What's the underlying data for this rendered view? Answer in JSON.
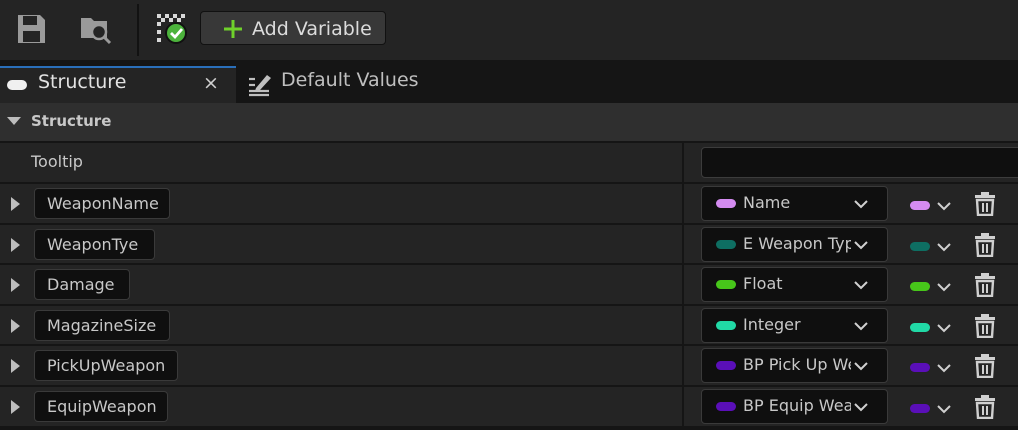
{
  "toolbar": {
    "save_icon": "save-icon",
    "browse_icon": "browse-folder-icon",
    "compile_icon": "compile-ok-icon",
    "add_variable_label": "Add Variable"
  },
  "tabs": [
    {
      "label": "Structure",
      "active": true,
      "close": "×"
    },
    {
      "label": "Default Values",
      "active": false
    }
  ],
  "section": {
    "title": "Structure"
  },
  "tooltip": {
    "label": "Tooltip",
    "value": ""
  },
  "variables": [
    {
      "name": "WeaponName",
      "type": "Name",
      "color": "#d48bf0"
    },
    {
      "name": "WeaponTye",
      "type": "E Weapon Type",
      "color": "#0e6e62"
    },
    {
      "name": "Damage",
      "type": "Float",
      "color": "#47c61a"
    },
    {
      "name": "MagazineSize",
      "type": "Integer",
      "color": "#21d9a6"
    },
    {
      "name": "PickUpWeapon",
      "type": "BP Pick Up Weapon",
      "color": "#5a0fb8"
    },
    {
      "name": "EquipWeapon",
      "type": "BP Equip Weapon",
      "color": "#5a0fb8"
    }
  ],
  "colors": {
    "accent": "#2a6fba",
    "add_plus": "#6fd12b",
    "compile_ok": "#4cb33c"
  }
}
